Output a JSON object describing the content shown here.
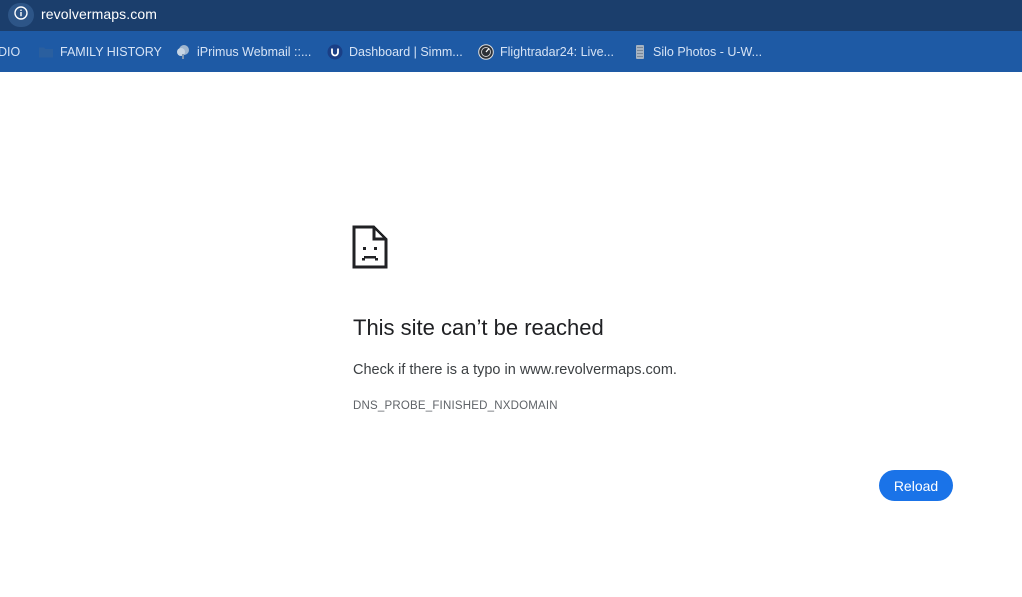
{
  "browser": {
    "url": "revolvermaps.com",
    "site_info_icon": "info-icon"
  },
  "bookmarks": [
    {
      "label": "DIO",
      "icon": "none"
    },
    {
      "label": "FAMILY HISTORY",
      "icon": "folder-icon"
    },
    {
      "label": "iPrimus Webmail ::...",
      "icon": "iprimus-icon"
    },
    {
      "label": "Dashboard | Simm...",
      "icon": "u-logo-icon"
    },
    {
      "label": "Flightradar24: Live...",
      "icon": "flightradar-icon"
    },
    {
      "label": "Silo Photos - U-W...",
      "icon": "silo-icon"
    }
  ],
  "error_page": {
    "icon": "sad-page-icon",
    "heading": "This site can’t be reached",
    "suggestion": "Check if there is a typo in www.revolvermaps.com.",
    "error_code": "DNS_PROBE_FINISHED_NXDOMAIN",
    "reload_label": "Reload"
  },
  "colors": {
    "top_bar": "#1b3e6c",
    "bookmarks_bar": "#1e5aa5",
    "reload_button": "#1a73e8"
  }
}
